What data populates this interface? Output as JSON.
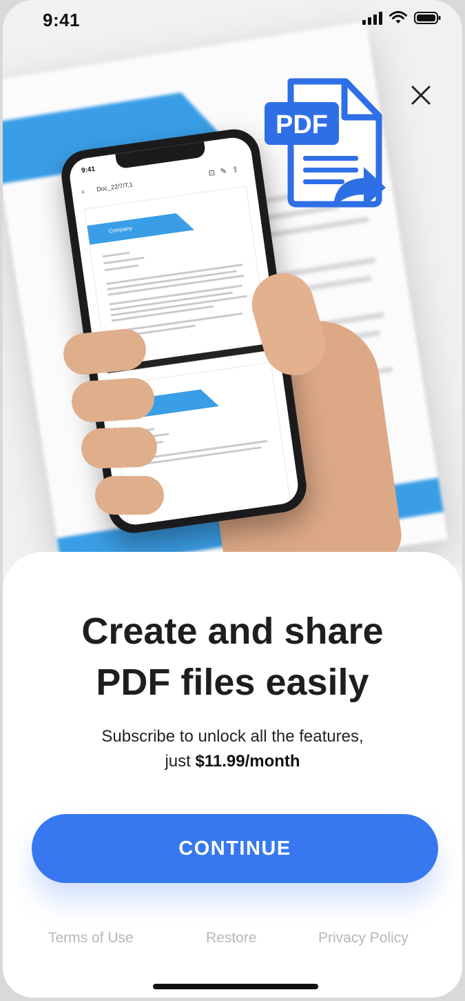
{
  "status_bar": {
    "time": "9:41"
  },
  "hero": {
    "pdf_badge": "PDF",
    "mock_phone": {
      "time": "9:41",
      "doc_title": "Doc_22/7/T,1",
      "company": "Company"
    }
  },
  "sheet": {
    "headline_line1": "Create and share",
    "headline_line2": "PDF files easily",
    "subtitle_prefix": "Subscribe to unlock all the features,",
    "subtitle_just": "just",
    "subtitle_price": "$11.99/month",
    "cta_label": "CONTINUE",
    "links": {
      "terms": "Terms of Use",
      "restore": "Restore",
      "privacy": "Privacy Policy"
    }
  },
  "colors": {
    "accent": "#3778f0",
    "doc_blue": "#3a9ee6",
    "link_grey": "#b7b7bb"
  }
}
